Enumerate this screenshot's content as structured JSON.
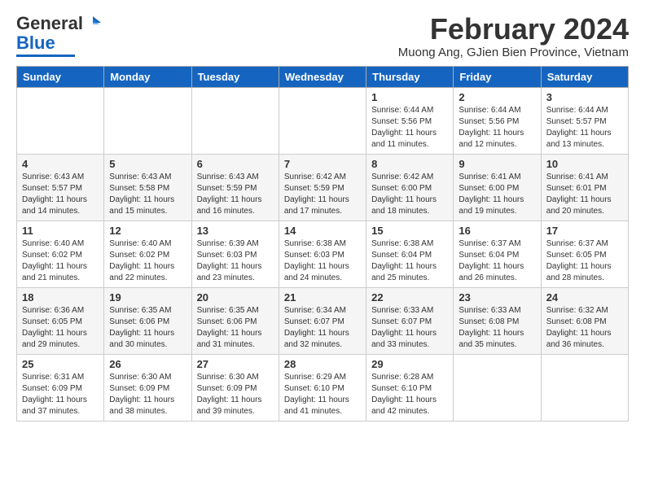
{
  "header": {
    "logo_general": "General",
    "logo_blue": "Blue",
    "month_title": "February 2024",
    "location": "Muong Ang, GJien Bien Province, Vietnam"
  },
  "weekdays": [
    "Sunday",
    "Monday",
    "Tuesday",
    "Wednesday",
    "Thursday",
    "Friday",
    "Saturday"
  ],
  "weeks": [
    [
      {
        "day": "",
        "info": ""
      },
      {
        "day": "",
        "info": ""
      },
      {
        "day": "",
        "info": ""
      },
      {
        "day": "",
        "info": ""
      },
      {
        "day": "1",
        "info": "Sunrise: 6:44 AM\nSunset: 5:56 PM\nDaylight: 11 hours\nand 11 minutes."
      },
      {
        "day": "2",
        "info": "Sunrise: 6:44 AM\nSunset: 5:56 PM\nDaylight: 11 hours\nand 12 minutes."
      },
      {
        "day": "3",
        "info": "Sunrise: 6:44 AM\nSunset: 5:57 PM\nDaylight: 11 hours\nand 13 minutes."
      }
    ],
    [
      {
        "day": "4",
        "info": "Sunrise: 6:43 AM\nSunset: 5:57 PM\nDaylight: 11 hours\nand 14 minutes."
      },
      {
        "day": "5",
        "info": "Sunrise: 6:43 AM\nSunset: 5:58 PM\nDaylight: 11 hours\nand 15 minutes."
      },
      {
        "day": "6",
        "info": "Sunrise: 6:43 AM\nSunset: 5:59 PM\nDaylight: 11 hours\nand 16 minutes."
      },
      {
        "day": "7",
        "info": "Sunrise: 6:42 AM\nSunset: 5:59 PM\nDaylight: 11 hours\nand 17 minutes."
      },
      {
        "day": "8",
        "info": "Sunrise: 6:42 AM\nSunset: 6:00 PM\nDaylight: 11 hours\nand 18 minutes."
      },
      {
        "day": "9",
        "info": "Sunrise: 6:41 AM\nSunset: 6:00 PM\nDaylight: 11 hours\nand 19 minutes."
      },
      {
        "day": "10",
        "info": "Sunrise: 6:41 AM\nSunset: 6:01 PM\nDaylight: 11 hours\nand 20 minutes."
      }
    ],
    [
      {
        "day": "11",
        "info": "Sunrise: 6:40 AM\nSunset: 6:02 PM\nDaylight: 11 hours\nand 21 minutes."
      },
      {
        "day": "12",
        "info": "Sunrise: 6:40 AM\nSunset: 6:02 PM\nDaylight: 11 hours\nand 22 minutes."
      },
      {
        "day": "13",
        "info": "Sunrise: 6:39 AM\nSunset: 6:03 PM\nDaylight: 11 hours\nand 23 minutes."
      },
      {
        "day": "14",
        "info": "Sunrise: 6:38 AM\nSunset: 6:03 PM\nDaylight: 11 hours\nand 24 minutes."
      },
      {
        "day": "15",
        "info": "Sunrise: 6:38 AM\nSunset: 6:04 PM\nDaylight: 11 hours\nand 25 minutes."
      },
      {
        "day": "16",
        "info": "Sunrise: 6:37 AM\nSunset: 6:04 PM\nDaylight: 11 hours\nand 26 minutes."
      },
      {
        "day": "17",
        "info": "Sunrise: 6:37 AM\nSunset: 6:05 PM\nDaylight: 11 hours\nand 28 minutes."
      }
    ],
    [
      {
        "day": "18",
        "info": "Sunrise: 6:36 AM\nSunset: 6:05 PM\nDaylight: 11 hours\nand 29 minutes."
      },
      {
        "day": "19",
        "info": "Sunrise: 6:35 AM\nSunset: 6:06 PM\nDaylight: 11 hours\nand 30 minutes."
      },
      {
        "day": "20",
        "info": "Sunrise: 6:35 AM\nSunset: 6:06 PM\nDaylight: 11 hours\nand 31 minutes."
      },
      {
        "day": "21",
        "info": "Sunrise: 6:34 AM\nSunset: 6:07 PM\nDaylight: 11 hours\nand 32 minutes."
      },
      {
        "day": "22",
        "info": "Sunrise: 6:33 AM\nSunset: 6:07 PM\nDaylight: 11 hours\nand 33 minutes."
      },
      {
        "day": "23",
        "info": "Sunrise: 6:33 AM\nSunset: 6:08 PM\nDaylight: 11 hours\nand 35 minutes."
      },
      {
        "day": "24",
        "info": "Sunrise: 6:32 AM\nSunset: 6:08 PM\nDaylight: 11 hours\nand 36 minutes."
      }
    ],
    [
      {
        "day": "25",
        "info": "Sunrise: 6:31 AM\nSunset: 6:09 PM\nDaylight: 11 hours\nand 37 minutes."
      },
      {
        "day": "26",
        "info": "Sunrise: 6:30 AM\nSunset: 6:09 PM\nDaylight: 11 hours\nand 38 minutes."
      },
      {
        "day": "27",
        "info": "Sunrise: 6:30 AM\nSunset: 6:09 PM\nDaylight: 11 hours\nand 39 minutes."
      },
      {
        "day": "28",
        "info": "Sunrise: 6:29 AM\nSunset: 6:10 PM\nDaylight: 11 hours\nand 41 minutes."
      },
      {
        "day": "29",
        "info": "Sunrise: 6:28 AM\nSunset: 6:10 PM\nDaylight: 11 hours\nand 42 minutes."
      },
      {
        "day": "",
        "info": ""
      },
      {
        "day": "",
        "info": ""
      }
    ]
  ]
}
